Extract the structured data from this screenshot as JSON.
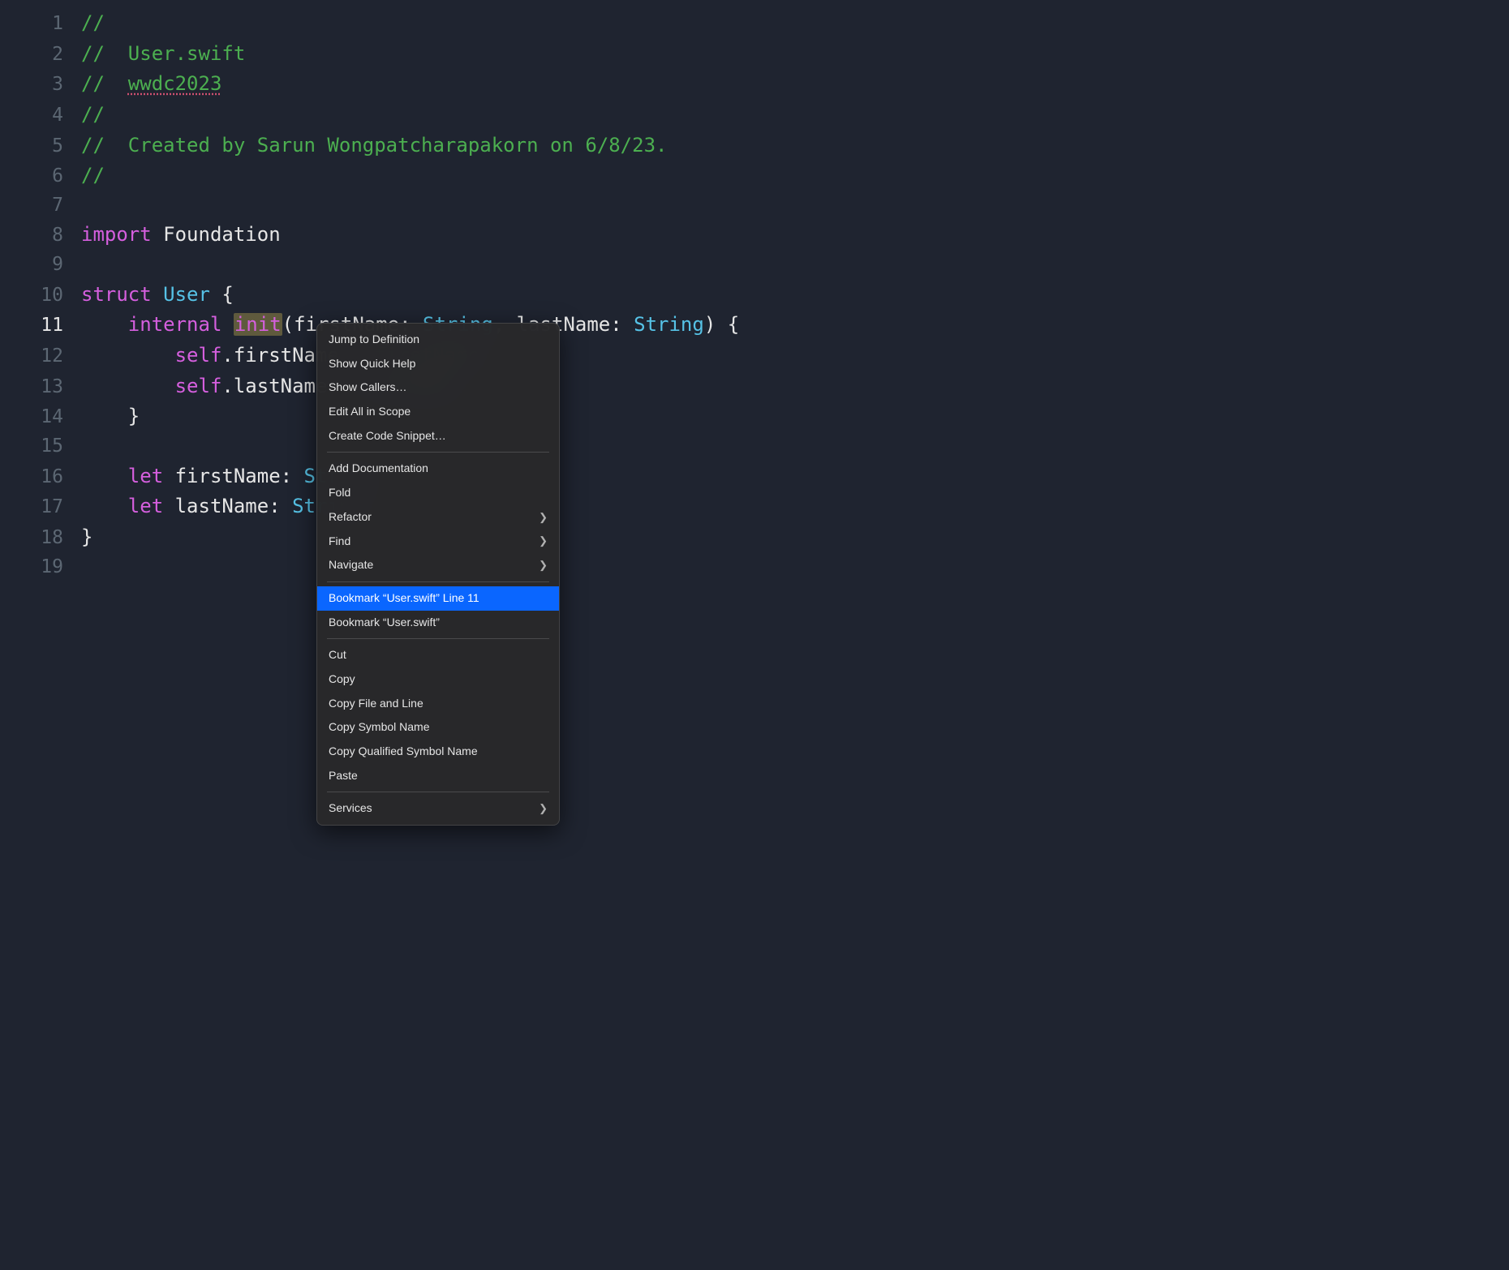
{
  "code": {
    "lines": [
      {
        "num": "1",
        "tokens": [
          {
            "t": "//",
            "cls": "c-green"
          }
        ]
      },
      {
        "num": "2",
        "tokens": [
          {
            "t": "//  ",
            "cls": "c-green"
          },
          {
            "t": "User.swift",
            "cls": "c-green"
          }
        ]
      },
      {
        "num": "3",
        "tokens": [
          {
            "t": "//  ",
            "cls": "c-green"
          },
          {
            "t": "wwdc2023",
            "cls": "c-green-u"
          }
        ]
      },
      {
        "num": "4",
        "tokens": [
          {
            "t": "//",
            "cls": "c-green"
          }
        ]
      },
      {
        "num": "5",
        "tokens": [
          {
            "t": "//  Created by Sarun Wongpatcharapakorn on 6/8/23.",
            "cls": "c-green"
          }
        ]
      },
      {
        "num": "6",
        "tokens": [
          {
            "t": "//",
            "cls": "c-green"
          }
        ]
      },
      {
        "num": "7",
        "tokens": [
          {
            "t": "",
            "cls": "c-plain"
          }
        ]
      },
      {
        "num": "8",
        "tokens": [
          {
            "t": "import",
            "cls": "c-keyword"
          },
          {
            "t": " Foundation",
            "cls": "c-plain"
          }
        ]
      },
      {
        "num": "9",
        "tokens": [
          {
            "t": "",
            "cls": "c-plain"
          }
        ]
      },
      {
        "num": "10",
        "tokens": [
          {
            "t": "struct",
            "cls": "c-keyword"
          },
          {
            "t": " ",
            "cls": "c-plain"
          },
          {
            "t": "User",
            "cls": "c-type"
          },
          {
            "t": " {",
            "cls": "c-plain"
          }
        ]
      },
      {
        "num": "11",
        "active": true,
        "tokens": [
          {
            "t": "    ",
            "cls": "c-plain"
          },
          {
            "t": "internal",
            "cls": "c-keyword"
          },
          {
            "t": " ",
            "cls": "c-plain"
          },
          {
            "t": "init",
            "cls": "c-keyword",
            "sel": true
          },
          {
            "t": "(firstName: ",
            "cls": "c-plain"
          },
          {
            "t": "String",
            "cls": "c-type"
          },
          {
            "t": ", lastName: ",
            "cls": "c-plain"
          },
          {
            "t": "String",
            "cls": "c-type"
          },
          {
            "t": ") {",
            "cls": "c-plain"
          }
        ]
      },
      {
        "num": "12",
        "tokens": [
          {
            "t": "        ",
            "cls": "c-plain"
          },
          {
            "t": "self",
            "cls": "c-self"
          },
          {
            "t": ".firstName = firstName",
            "cls": "c-plain"
          }
        ]
      },
      {
        "num": "13",
        "tokens": [
          {
            "t": "        ",
            "cls": "c-plain"
          },
          {
            "t": "self",
            "cls": "c-self"
          },
          {
            "t": ".lastName = lastName",
            "cls": "c-plain"
          }
        ]
      },
      {
        "num": "14",
        "tokens": [
          {
            "t": "    }",
            "cls": "c-plain"
          }
        ]
      },
      {
        "num": "15",
        "tokens": [
          {
            "t": "",
            "cls": "c-plain"
          }
        ]
      },
      {
        "num": "16",
        "tokens": [
          {
            "t": "    ",
            "cls": "c-plain"
          },
          {
            "t": "let",
            "cls": "c-keyword"
          },
          {
            "t": " firstName: ",
            "cls": "c-plain"
          },
          {
            "t": "String",
            "cls": "c-type"
          }
        ]
      },
      {
        "num": "17",
        "tokens": [
          {
            "t": "    ",
            "cls": "c-plain"
          },
          {
            "t": "let",
            "cls": "c-keyword"
          },
          {
            "t": " lastName: ",
            "cls": "c-plain"
          },
          {
            "t": "String",
            "cls": "c-type"
          }
        ]
      },
      {
        "num": "18",
        "tokens": [
          {
            "t": "}",
            "cls": "c-plain"
          }
        ]
      },
      {
        "num": "19",
        "tokens": [
          {
            "t": "",
            "cls": "c-plain"
          }
        ]
      }
    ]
  },
  "contextMenu": {
    "groups": [
      [
        {
          "label": "Jump to Definition",
          "submenu": false
        },
        {
          "label": "Show Quick Help",
          "submenu": false
        },
        {
          "label": "Show Callers…",
          "submenu": false
        },
        {
          "label": "Edit All in Scope",
          "submenu": false
        },
        {
          "label": "Create Code Snippet…",
          "submenu": false
        }
      ],
      [
        {
          "label": "Add Documentation",
          "submenu": false
        },
        {
          "label": "Fold",
          "submenu": false
        },
        {
          "label": "Refactor",
          "submenu": true
        },
        {
          "label": "Find",
          "submenu": true
        },
        {
          "label": "Navigate",
          "submenu": true
        }
      ],
      [
        {
          "label": "Bookmark “User.swift” Line 11",
          "submenu": false,
          "highlighted": true
        },
        {
          "label": "Bookmark “User.swift”",
          "submenu": false
        }
      ],
      [
        {
          "label": "Cut",
          "submenu": false
        },
        {
          "label": "Copy",
          "submenu": false
        },
        {
          "label": "Copy File and Line",
          "submenu": false
        },
        {
          "label": "Copy Symbol Name",
          "submenu": false
        },
        {
          "label": "Copy Qualified Symbol Name",
          "submenu": false
        },
        {
          "label": "Paste",
          "submenu": false
        }
      ],
      [
        {
          "label": "Services",
          "submenu": true
        }
      ]
    ]
  },
  "colors": {
    "comment": "#4caf50",
    "keyword": "#d55fde",
    "type": "#56c2e6",
    "plain": "#e6e6e6",
    "bg": "#1f2430",
    "highlight": "#0a66ff"
  }
}
